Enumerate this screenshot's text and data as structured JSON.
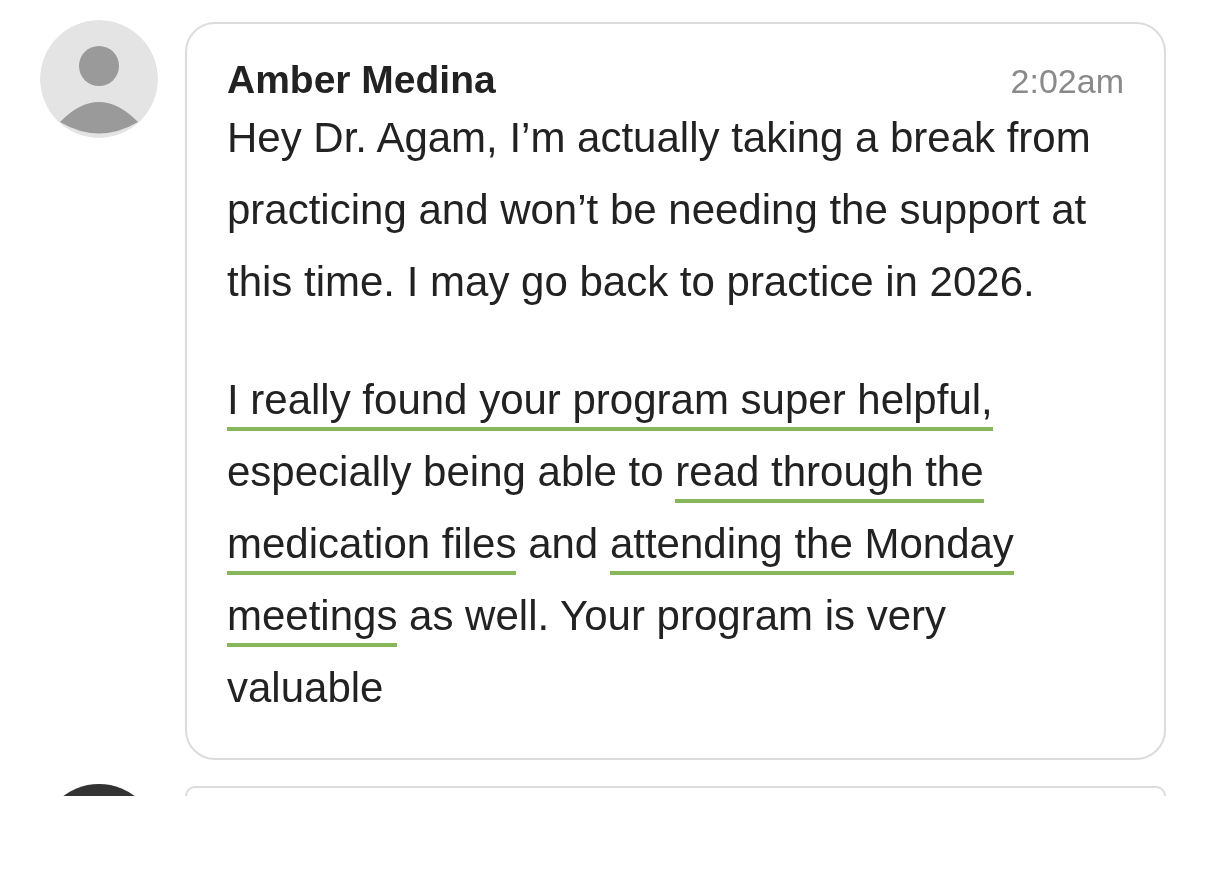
{
  "messages": [
    {
      "sender": "Amber Medina",
      "time": "2:02am",
      "paragraphs": [
        [
          {
            "text": "Hey Dr. Agam, I’m actually taking a break from practicing and won’t be needing the support at this time. I may go back to practice in 2026.",
            "highlighted": false
          }
        ],
        [
          {
            "text": "I really found your program super helpful,",
            "highlighted": true
          },
          {
            "text": " especially being able to ",
            "highlighted": false
          },
          {
            "text": "read through the medication files",
            "highlighted": true
          },
          {
            "text": " and ",
            "highlighted": false
          },
          {
            "text": "attending the Monday meetings",
            "highlighted": true
          },
          {
            "text": " as well. Your program is very valuable",
            "highlighted": false
          }
        ]
      ]
    },
    {
      "kind": "cut_off"
    }
  ]
}
